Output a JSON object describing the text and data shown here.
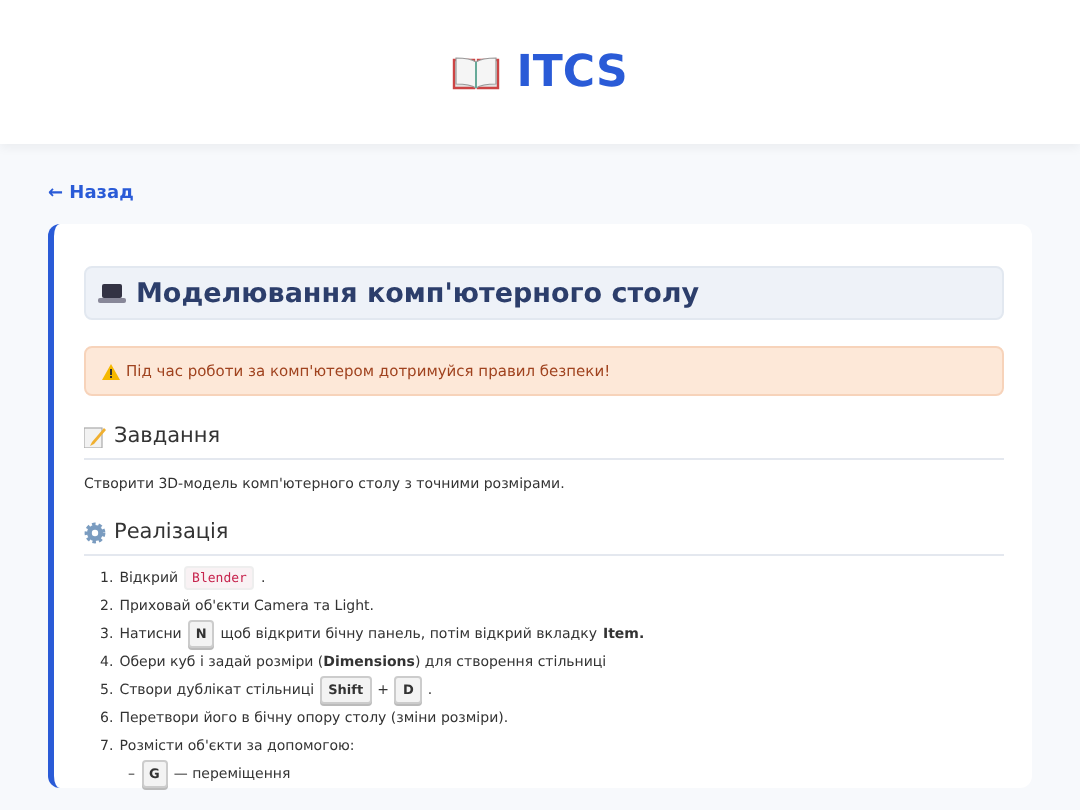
{
  "header": {
    "title": "ITCS"
  },
  "back_link": "← Назад",
  "lesson": {
    "title": "Моделювання комп'ютерного столу",
    "alert": "Під час роботи за комп'ютером дотримуйся правил безпеки!",
    "sections": [
      {
        "kind": "task",
        "heading": "Завдання",
        "text": "Створити 3D-модель комп'ютерного столу з точними розмірами."
      },
      {
        "kind": "steps",
        "heading": "Реалізація",
        "items": [
          {
            "number": "1.",
            "parts": [
              {
                "kind": "text",
                "text": "Відкрий"
              },
              {
                "kind": "code",
                "text": "Blender"
              },
              {
                "kind": "text",
                "text": "."
              }
            ]
          },
          {
            "number": "2.",
            "parts": [
              {
                "kind": "text",
                "text": "Приховай об'єкти Camera та Light."
              }
            ]
          },
          {
            "number": "3.",
            "parts": [
              {
                "kind": "text",
                "text": "Натисни"
              },
              {
                "kind": "key",
                "text": "N"
              },
              {
                "kind": "text",
                "text": "щоб відкрити бічну панель, потім відкрий вкладку"
              },
              {
                "kind": "bold",
                "text": "Item."
              }
            ]
          },
          {
            "number": "4.",
            "parts": [
              {
                "kind": "text",
                "text": "Обери куб і задай розміри (**Dimensions**) для створення стільниці"
              }
            ]
          },
          {
            "number": "5.",
            "parts": [
              {
                "kind": "text",
                "text": "Створи дублікат стільниці"
              },
              {
                "kind": "key",
                "text": "Shift"
              },
              {
                "kind": "text",
                "text": "+"
              },
              {
                "kind": "key",
                "text": "D"
              },
              {
                "kind": "text",
                "text": "."
              }
            ]
          },
          {
            "number": "6.",
            "parts": [
              {
                "kind": "text",
                "text": "Перетвори його в бічну опору столу (зміни розміри)."
              }
            ]
          },
          {
            "number": "7.",
            "parts": [
              {
                "kind": "text",
                "text": "Розмісти об'єкти за допомогою:"
              }
            ],
            "children": [
              {
                "number": "–",
                "parts": [
                  {
                    "kind": "key",
                    "text": "G"
                  },
                  {
                    "kind": "text",
                    "text": "— переміщення"
                  }
                ]
              }
            ]
          }
        ]
      }
    ]
  }
}
